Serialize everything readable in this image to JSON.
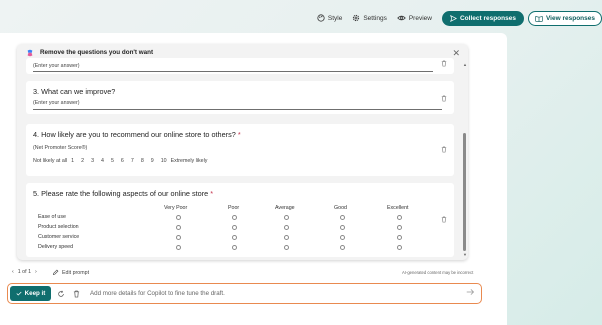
{
  "toolbar": {
    "style_label": "Style",
    "settings_label": "Settings",
    "preview_label": "Preview",
    "collect_label": "Collect responses",
    "view_label": "View responses"
  },
  "card": {
    "header": "Remove the questions you don't want"
  },
  "questions": {
    "q2_answer": "(Enter your answer)",
    "q3": {
      "title": "3. What can we improve?",
      "answer": "(Enter your answer)"
    },
    "q4": {
      "title": "4. How likely are you to recommend our online store to others?",
      "required": "*",
      "subtitle": "(Net Promoter Score®)",
      "low_label": "Not likely at all",
      "scale": [
        "1",
        "2",
        "3",
        "4",
        "5",
        "6",
        "7",
        "8",
        "9",
        "10"
      ],
      "high_label": "Extremely likely"
    },
    "q5": {
      "title": "5. Please rate the following aspects of our online store",
      "required": "*",
      "columns": [
        "Very Poor",
        "Poor",
        "Average",
        "Good",
        "Excellent"
      ],
      "rows": [
        "Ease of use",
        "Product selection",
        "Customer service",
        "Delivery speed"
      ]
    }
  },
  "footer": {
    "pager": "1 of 1",
    "edit_prompt": "Edit prompt",
    "ai_note": "AI-generated content may be incorrect"
  },
  "prompt_bar": {
    "keep_label": "Keep it",
    "placeholder": "Add more details for Copilot to fine tune the draft."
  },
  "colors": {
    "accent": "#0f6e6e",
    "prompt_border": "#e98a50"
  }
}
